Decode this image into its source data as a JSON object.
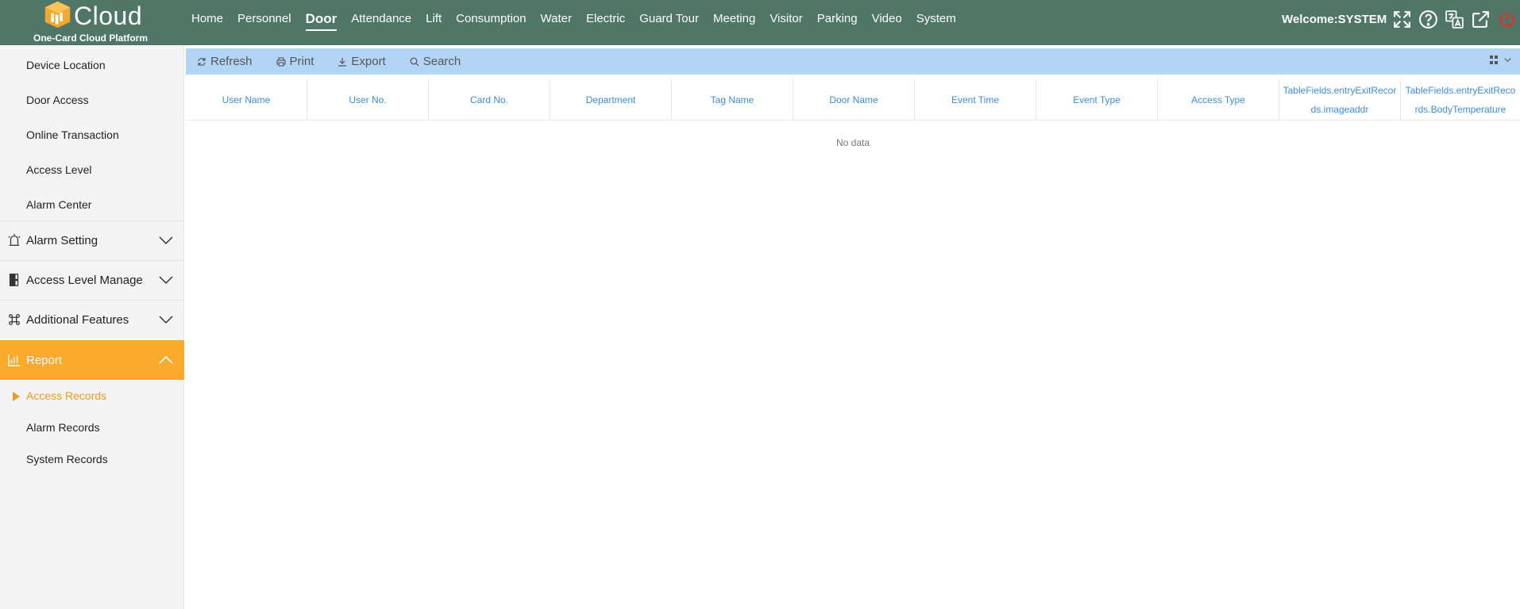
{
  "brand": {
    "name": "Cloud",
    "subtitle": "One-Card Cloud Platform"
  },
  "nav": {
    "items": [
      "Home",
      "Personnel",
      "Door",
      "Attendance",
      "Lift",
      "Consumption",
      "Water",
      "Electric",
      "Guard Tour",
      "Meeting",
      "Visitor",
      "Parking",
      "Video",
      "System"
    ],
    "active": "Door"
  },
  "header": {
    "welcome": "Welcome:SYSTEM",
    "icons": [
      "fullscreen-icon",
      "help-icon",
      "language-icon",
      "external-link-icon",
      "power-icon"
    ]
  },
  "sidebar": {
    "door_items": [
      "Device Location",
      "Door Access",
      "Online Transaction",
      "Access Level",
      "Alarm Center"
    ],
    "groups": [
      {
        "label": "Alarm Setting",
        "icon": "alarm-icon",
        "expanded": false
      },
      {
        "label": "Access Level Manage",
        "icon": "door-icon",
        "expanded": false
      },
      {
        "label": "Additional Features",
        "icon": "command-icon",
        "expanded": false
      },
      {
        "label": "Report",
        "icon": "report-chart-icon",
        "expanded": true
      }
    ],
    "report_items": [
      "Access Records",
      "Alarm Records",
      "System Records"
    ],
    "active_item": "Access Records"
  },
  "toolbar": {
    "refresh": "Refresh",
    "print": "Print",
    "export": "Export",
    "search": "Search"
  },
  "table": {
    "columns": [
      "User Name",
      "User No.",
      "Card No.",
      "Department",
      "Tag Name",
      "Door Name",
      "Event Time",
      "Event Type",
      "Access Type",
      "TableFields.entryExitRecords.imageaddr",
      "TableFields.entryExitRecords.BodyTemperature"
    ],
    "empty_text": "No data"
  },
  "colors": {
    "header_bg": "#4f7667",
    "accent_orange": "#fbaa2b",
    "toolbar_bg": "#b3d5f5",
    "link_blue": "#3b8ee6"
  }
}
